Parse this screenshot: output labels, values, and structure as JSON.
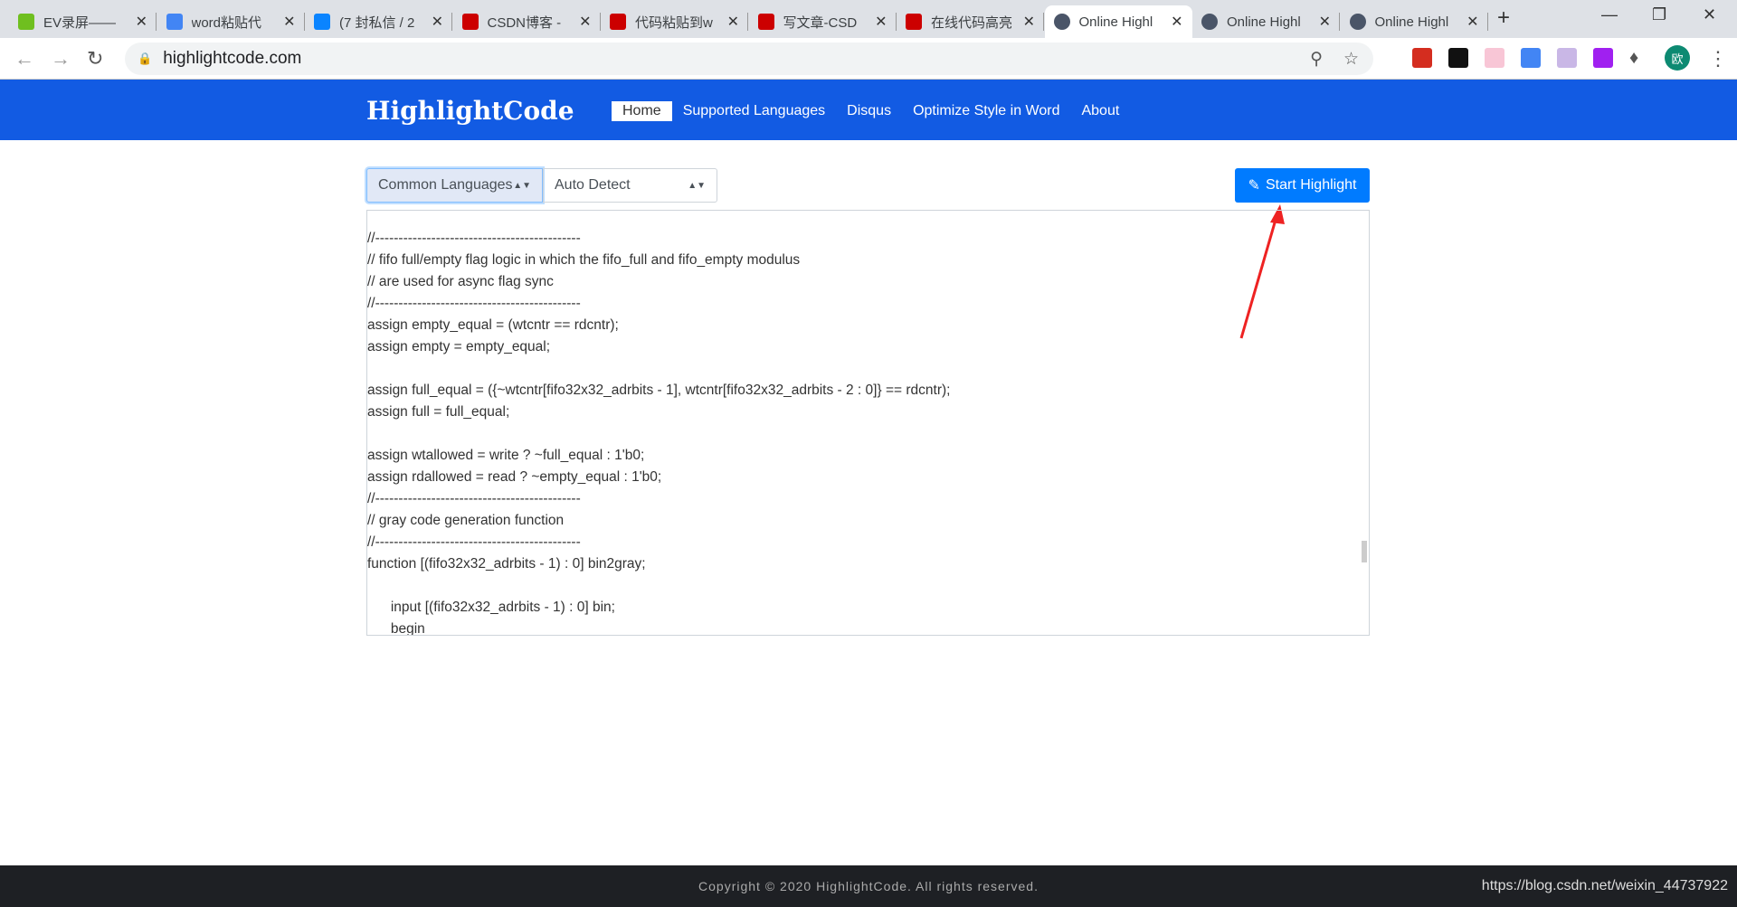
{
  "browser": {
    "tabs": [
      {
        "title": "EV录屏——",
        "icon": "ev-icon",
        "color": "#6fbf1f"
      },
      {
        "title": "word粘贴代",
        "icon": "google-icon",
        "color": "#4285f4"
      },
      {
        "title": "(7 封私信 / 2",
        "icon": "zhihu-icon",
        "color": "#0a84ff"
      },
      {
        "title": "CSDN博客 -",
        "icon": "csdn-icon",
        "color": "#c00"
      },
      {
        "title": "代码粘贴到w",
        "icon": "csdn-icon",
        "color": "#c00"
      },
      {
        "title": "写文章-CSD",
        "icon": "csdn-icon",
        "color": "#c00"
      },
      {
        "title": "在线代码高亮",
        "icon": "csdn-icon",
        "color": "#c00"
      },
      {
        "title": "Online Highl",
        "icon": "highlightcode-icon",
        "color": "#4a5568",
        "active": true
      },
      {
        "title": "Online Highl",
        "icon": "highlightcode-icon",
        "color": "#4a5568"
      },
      {
        "title": "Online Highl",
        "icon": "highlightcode-icon",
        "color": "#4a5568"
      }
    ],
    "url": "highlightcode.com",
    "profile_initial": "欧"
  },
  "header": {
    "logo": "HighlightCode",
    "nav": [
      "Home",
      "Supported Languages",
      "Disqus",
      "Optimize Style in Word",
      "About"
    ],
    "accent": "#125be3"
  },
  "controls": {
    "category_select": "Common Languages",
    "language_select": "Auto Detect",
    "start_button": "Start Highlight",
    "button_color": "#007bff"
  },
  "code_lines": [
    "//--------------------------------------------",
    "// fifo full/empty flag logic in which the fifo_full and fifo_empty modulus",
    "// are used for async flag sync",
    "//--------------------------------------------",
    "assign empty_equal = (wtcntr == rdcntr);",
    "assign empty = empty_equal;",
    "",
    "assign full_equal = ({~wtcntr[fifo32x32_adrbits - 1], wtcntr[fifo32x32_adrbits - 2 : 0]} == rdcntr);",
    "assign full = full_equal;",
    "",
    "assign wtallowed = write ? ~full_equal : 1'b0;",
    "assign rdallowed = read ? ~empty_equal : 1'b0;",
    "//--------------------------------------------",
    "// gray code generation function",
    "//--------------------------------------------",
    "function [(fifo32x32_adrbits - 1) : 0] bin2gray;",
    "",
    "      input [(fifo32x32_adrbits - 1) : 0] bin;",
    "      begin"
  ],
  "footer": {
    "copyright": "Copyright © 2020 HighlightCode. All rights reserved.",
    "watermark": "https://blog.csdn.net/weixin_44737922"
  }
}
